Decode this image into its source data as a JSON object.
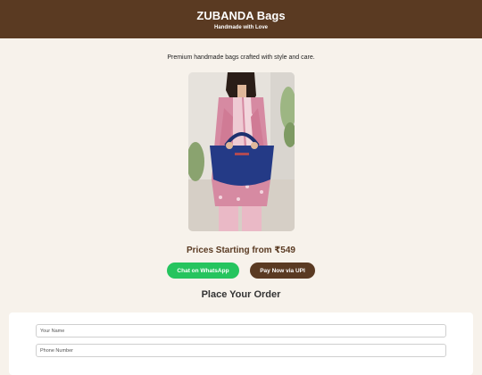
{
  "header": {
    "title": "ZUBANDA Bags",
    "tagline": "Handmade with Love"
  },
  "intro": {
    "text": "Premium handmade bags crafted with style and care."
  },
  "product": {
    "image": "woman-holding-navy-handbag-photo"
  },
  "pricing": {
    "text": "Prices Starting from ₹549"
  },
  "actions": {
    "whatsapp_label": "Chat on WhatsApp",
    "upi_label": "Pay Now via UPI",
    "whatsapp_color": "#25c45e",
    "brand_color": "#5a3a22"
  },
  "order": {
    "title": "Place Your Order",
    "name_placeholder": "Your Name",
    "phone_placeholder": "Phone Number"
  }
}
